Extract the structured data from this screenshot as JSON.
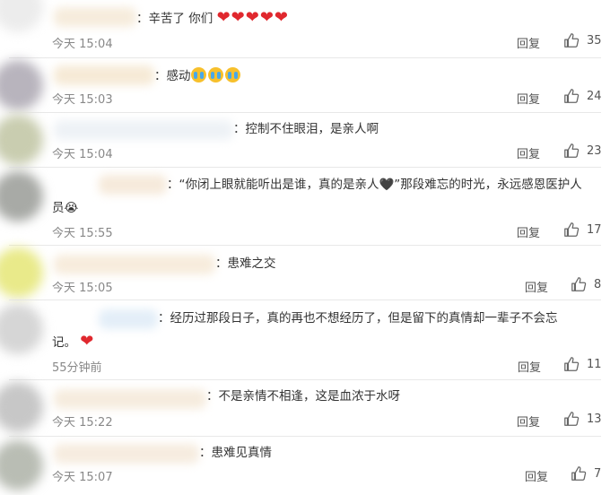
{
  "comments": [
    {
      "text": "：辛苦了 你们",
      "hearts": "❤❤❤❤❤",
      "time": "今天 15:04",
      "reply": "回复",
      "likes": "35"
    },
    {
      "text": "：感动",
      "cry_count": 3,
      "time": "今天 15:03",
      "reply": "回复",
      "likes": "24"
    },
    {
      "text": "：控制不住眼泪，是亲人啊",
      "time": "今天 15:04",
      "reply": "回复",
      "likes": "23"
    },
    {
      "text_line1": "：“你闭上眼就能听出是谁，真的是亲人🖤”那段难忘的时光，永远感恩医护人",
      "text_line2": "员😭",
      "time": "今天 15:55",
      "reply": "回复",
      "likes": "17"
    },
    {
      "text": "：患难之交",
      "time": "今天 15:05",
      "reply": "回复",
      "likes": "8"
    },
    {
      "text_line1": "：经历过那段日子，真的再也不想经历了，但是留下的真情却一辈子不会忘",
      "text_line2": "记。",
      "heart": "❤",
      "time": "55分钟前",
      "reply": "回复",
      "likes": "11"
    },
    {
      "text": "：不是亲情不相逢，这是血浓于水呀",
      "time": "今天 15:22",
      "reply": "回复",
      "likes": "13"
    },
    {
      "text": "：患难见真情",
      "time": "今天 15:07",
      "reply": "回复",
      "likes": "7"
    }
  ],
  "colors": {
    "heart": "#e0282e",
    "time": "#888888",
    "separator": "#e8e8e8"
  },
  "icons": {
    "like": "thumbs-up-icon"
  }
}
